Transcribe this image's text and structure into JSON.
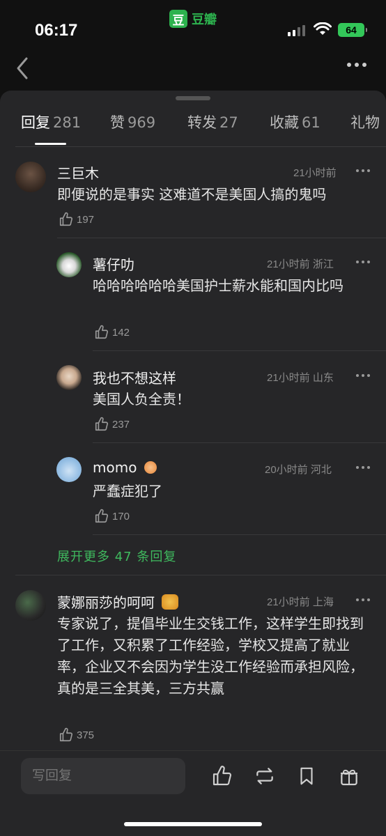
{
  "status_bar": {
    "time": "06:17",
    "app_name": "豆瓣",
    "app_logo_char": "豆",
    "battery": "64",
    "accent": "#2db24e"
  },
  "nav": {
    "back_icon": "chevron-left-icon",
    "more_icon": "more-horizontal-icon"
  },
  "tabs": [
    {
      "label": "回复",
      "count": "281",
      "active": true
    },
    {
      "label": "赞",
      "count": "969",
      "active": false
    },
    {
      "label": "转发",
      "count": "27",
      "active": false
    },
    {
      "label": "收藏",
      "count": "61",
      "active": false
    },
    {
      "label": "礼物",
      "count": "",
      "active": false
    }
  ],
  "comments": [
    {
      "name": "三巨木",
      "time": "21小时前",
      "location": "",
      "text": "即便说的是事实 这难道不是美国人搞的鬼吗",
      "likes": "197"
    },
    {
      "name": "薯仔叻",
      "time": "21小时前",
      "location": "浙江",
      "text": "哈哈哈哈哈哈美国护士薪水能和国内比吗",
      "likes": "142"
    },
    {
      "name": "我也不想这样",
      "time": "21小时前",
      "location": "山东",
      "text": "美国人负全责！",
      "likes": "237"
    },
    {
      "name": "momo",
      "time": "20小时前",
      "location": "河北",
      "text": "严蠢症犯了",
      "likes": "170"
    },
    {
      "name": "蒙娜丽莎的呵呵",
      "time": "21小时前",
      "location": "上海",
      "text": "专家说了，提倡毕业生交钱工作，这样学生即找到了工作，又积累了工作经验，学校又提高了就业率，企业又不会因为学生没工作经验而承担风险，真的是三全其美，三方共赢",
      "likes": "375"
    }
  ],
  "expand_replies": "展开更多 47 条回复",
  "bottom": {
    "reply_placeholder": "写回复"
  },
  "colors": {
    "background": "#111111",
    "sheet": "#262628",
    "green": "#3fb95e"
  }
}
